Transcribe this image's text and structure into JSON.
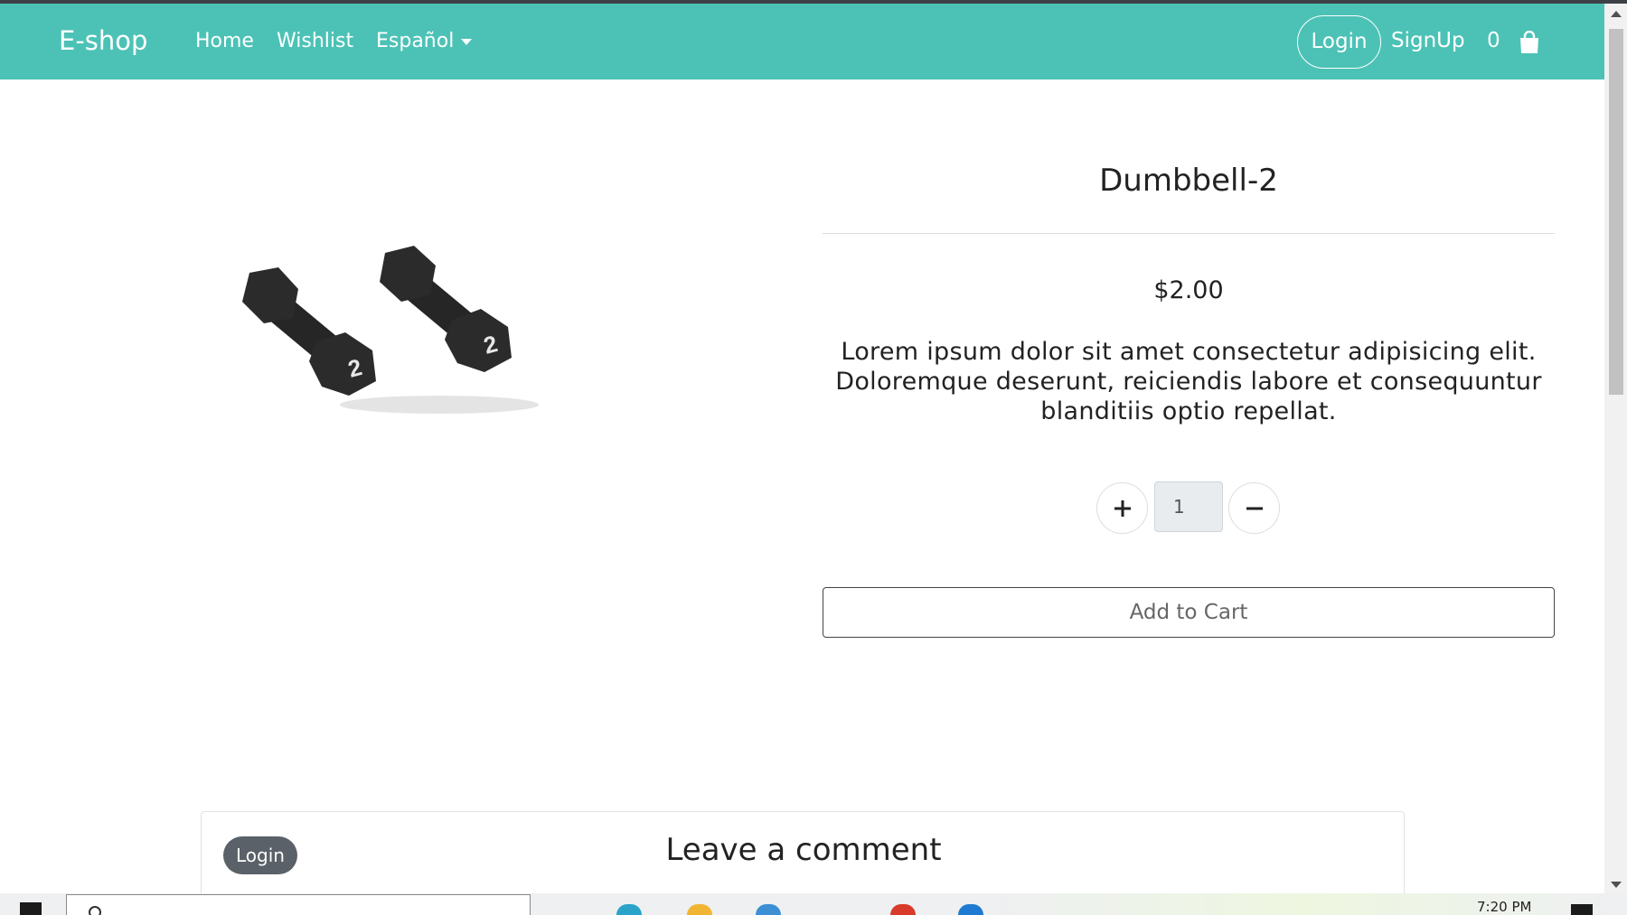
{
  "navbar": {
    "brand": "E-shop",
    "links": [
      "Home",
      "Wishlist",
      "Español"
    ],
    "login": "Login",
    "signup": "SignUp",
    "cart_count": "0",
    "cart_icon": "shopping-bag-icon",
    "background": "#4cc2b6"
  },
  "product": {
    "image_icon": "dumbbell-pair-image",
    "title": "Dumbbell-2",
    "price": "$2.00",
    "description": "Lorem ipsum dolor sit amet consectetur adipisicing elit. Doloremque deserunt, reiciendis labore et consequuntur blanditiis optio repellat.",
    "quantity": "1",
    "add_to_cart": "Add to Cart"
  },
  "comments": {
    "login": "Login",
    "heading": "Leave a comment"
  },
  "taskbar": {
    "time": "7:20 PM"
  }
}
